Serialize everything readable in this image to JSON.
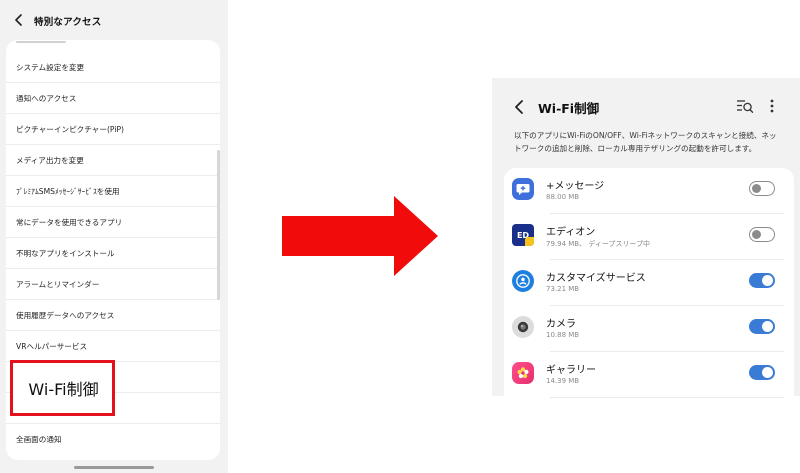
{
  "left": {
    "title": "特別なアクセス",
    "rows": [
      "システム設定を変更",
      "通知へのアクセス",
      "ピクチャーインピクチャー(PiP)",
      "メディア出力を変更",
      "ﾌﾟﾚﾐｱﾑSMSﾒｯｾｰｼﾞｻｰﾋﾞｽを使用",
      "常にデータを使用できるアプリ",
      "不明なアプリをインストール",
      "アラームとリマインダー",
      "使用履歴データへのアクセス",
      "VRヘルパーサービス",
      "",
      "",
      "全画面の通知"
    ],
    "highlight_label": "Wi-Fi制御",
    "highlight_color": "#e3111b"
  },
  "arrow": {
    "color": "#f20b0b"
  },
  "right": {
    "title": "Wi-Fi制御",
    "description": "以下のアプリにWi-FiのON/OFF、Wi-Fiネットワークのスキャンと接続、ネットワークの追加と削除、ローカル専用テザリングの起動を許可します。",
    "apps": [
      {
        "name": "+メッセージ",
        "size": "88.00 MB",
        "toggle": "off",
        "icon": "message-plus-icon",
        "icon_color": "#3f6fdc"
      },
      {
        "name": "エディオン",
        "size": "79.94 MB、 ディープスリープ中",
        "toggle": "off",
        "icon": "edion-icon",
        "icon_color": "#1a2f8a"
      },
      {
        "name": "カスタマイズサービス",
        "size": "73.21 MB",
        "toggle": "on",
        "icon": "customize-service-icon",
        "icon_color": "#1e7fe0"
      },
      {
        "name": "カメラ",
        "size": "10.88 MB",
        "toggle": "on",
        "icon": "camera-icon",
        "icon_color": "#dcdcdc"
      },
      {
        "name": "ギャラリー",
        "size": "14.39 MB",
        "toggle": "on",
        "icon": "gallery-icon",
        "icon_color": "#f23f8e"
      }
    ],
    "accent": "#3a7bd5"
  },
  "app_name_edion_badge": "ED"
}
